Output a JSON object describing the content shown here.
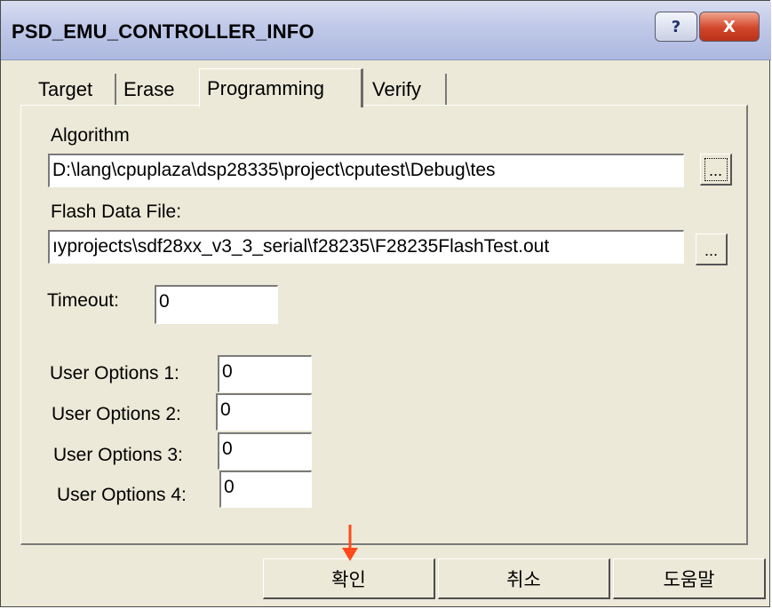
{
  "window": {
    "title": "PSD_EMU_CONTROLLER_INFO",
    "help_label": "?",
    "close_label": "X"
  },
  "tabs": [
    {
      "label": "Target"
    },
    {
      "label": "Erase"
    },
    {
      "label": "Programming"
    },
    {
      "label": "Verify"
    }
  ],
  "programming": {
    "algorithm_label": "Algorithm",
    "algorithm_value": "D:\\lang\\cpuplaza\\dsp28335\\project\\cputest\\Debug\\tes",
    "flash_label": "Flash Data File:",
    "flash_value": "ıyprojects\\sdf28xx_v3_3_serial\\f28235\\F28235FlashTest.out",
    "browse_label": "...",
    "timeout_label": "Timeout:",
    "timeout_value": "0",
    "user_options": [
      {
        "label": "User Options 1:",
        "value": "0"
      },
      {
        "label": "User Options 2:",
        "value": "0"
      },
      {
        "label": "User Options 3:",
        "value": "0"
      },
      {
        "label": "User Options 4:",
        "value": "0"
      }
    ]
  },
  "buttons": {
    "ok": "확인",
    "cancel": "취소",
    "help": "도움말"
  },
  "colors": {
    "arrow": "#ff4a1c",
    "dialog_bg": "#ece9d8",
    "titlebar": "#bfc8e8",
    "close": "#d2462a"
  }
}
